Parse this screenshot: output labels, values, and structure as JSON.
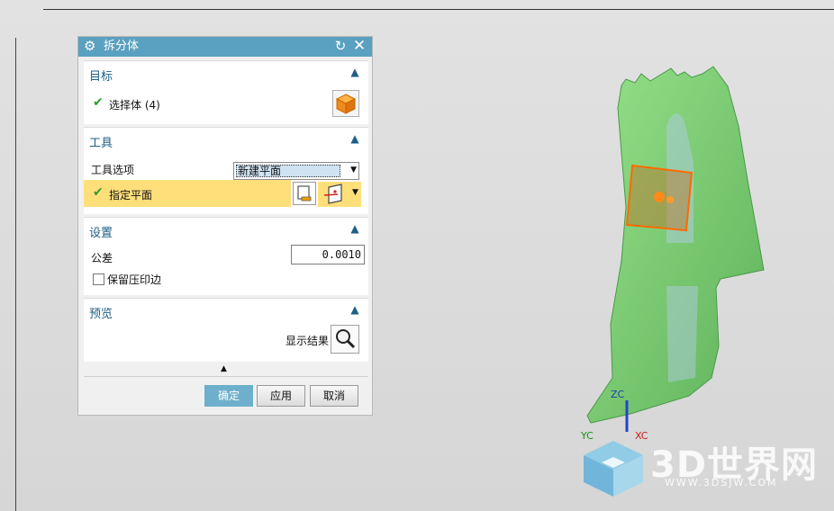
{
  "dialog": {
    "title": "拆分体",
    "target": {
      "header": "目标",
      "select_body": "选择体 (4)"
    },
    "tool": {
      "header": "工具",
      "option_label": "工具选项",
      "option_value": "新建平面",
      "specify_plane": "指定平面"
    },
    "settings": {
      "header": "设置",
      "tolerance_label": "公差",
      "tolerance_value": "0.0010",
      "keep_imprint": "保留压印边"
    },
    "preview": {
      "header": "预览",
      "show_result": "显示结果"
    },
    "buttons": {
      "ok": "确定",
      "apply": "应用",
      "cancel": "取消"
    }
  },
  "viewport": {
    "axes": {
      "zc": "ZC",
      "yc": "YC",
      "xc": "XC"
    },
    "watermark": "3D世界网",
    "watermark_url": "WWW.3DSJW.COM"
  },
  "colors": {
    "titlebar": "#5aa0c0",
    "section_header": "#1d5f86",
    "highlight_row": "#ffdf7a",
    "part_green": "#7fd07a"
  }
}
